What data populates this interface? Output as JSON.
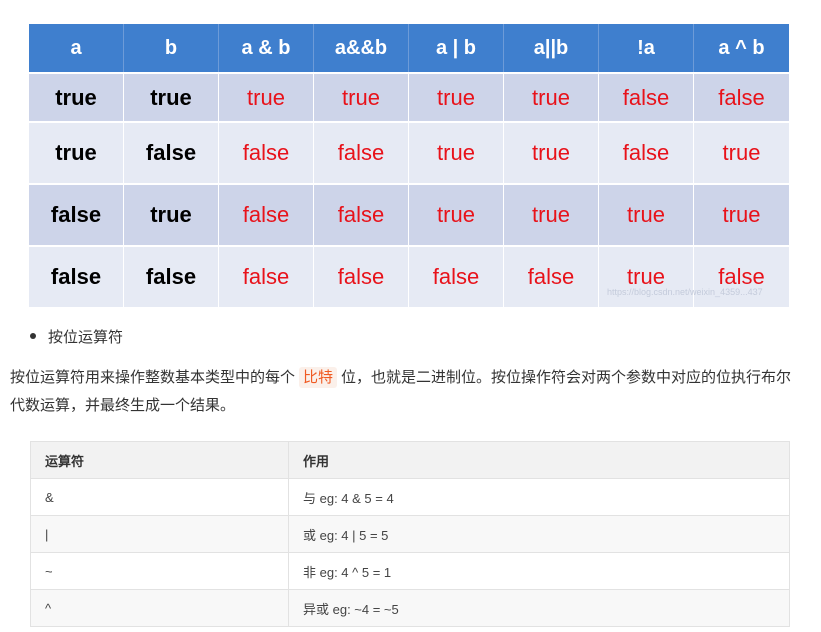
{
  "truth_table": {
    "headers": [
      "a",
      "b",
      "a & b",
      "a&&b",
      "a | b",
      "a||b",
      "!a",
      "a ^ b"
    ],
    "rows": [
      [
        "true",
        "true",
        "true",
        "true",
        "true",
        "true",
        "false",
        "false"
      ],
      [
        "true",
        "false",
        "false",
        "false",
        "true",
        "true",
        "false",
        "true"
      ],
      [
        "false",
        "true",
        "false",
        "false",
        "true",
        "true",
        "true",
        "true"
      ],
      [
        "false",
        "false",
        "false",
        "false",
        "false",
        "false",
        "true",
        "false"
      ]
    ],
    "watermark": "https://blog.csdn.net/weixin_4359...437"
  },
  "bullet": "按位运算符",
  "paragraph": {
    "before": "按位运算符用来操作整数基本类型中的每个",
    "highlight": "比特",
    "after": "位，也就是二进制位。按位操作符会对两个参数中对应的位执行布尔代数运算，并最终生成一个结果。"
  },
  "ops_table": {
    "headers": [
      "运算符",
      "作用"
    ],
    "rows": [
      [
        "&",
        "与 eg: 4 & 5 = 4"
      ],
      [
        "|",
        "或 eg: 4 | 5 = 5"
      ],
      [
        "~",
        "非 eg: 4 ^ 5 = 1"
      ],
      [
        "^",
        "异或 eg: ~4 = ~5"
      ]
    ]
  },
  "colors": {
    "header_blue": "#3f7fce",
    "result_red": "#e8121a",
    "highlight_orange": "#f05a22"
  }
}
